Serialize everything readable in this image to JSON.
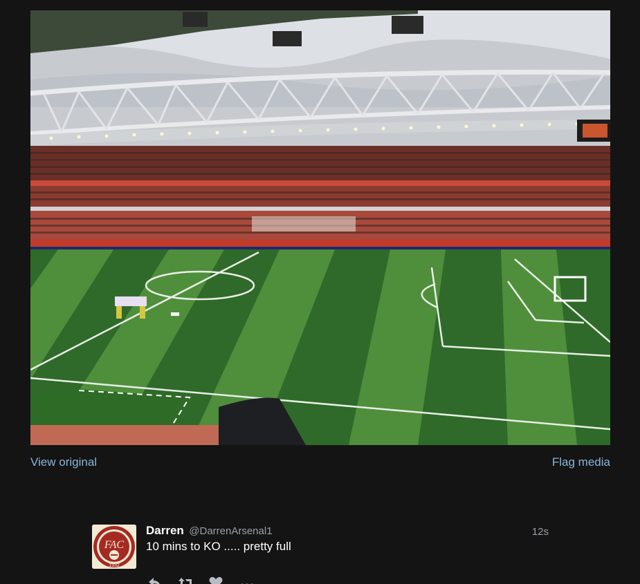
{
  "media": {
    "alt_kind": "stadium-photo"
  },
  "links": {
    "view_original": "View original",
    "flag_media": "Flag media"
  },
  "tweet": {
    "name": "Darren",
    "handle": "@DarrenArsenal1",
    "time": "12s",
    "text": "10 mins to KO ..... pretty full",
    "avatar_text": "FAC",
    "avatar_year": "1932"
  },
  "actions": {
    "reply_icon": "reply-icon",
    "retweet_icon": "retweet-icon",
    "like_icon": "heart-icon",
    "more_icon": "more-icon"
  },
  "colors": {
    "background": "#141414",
    "link": "#8ab4d8",
    "pitch_dark": "#2f6a2a",
    "pitch_light": "#4f8f3c",
    "stand_red": "#b8483a"
  }
}
